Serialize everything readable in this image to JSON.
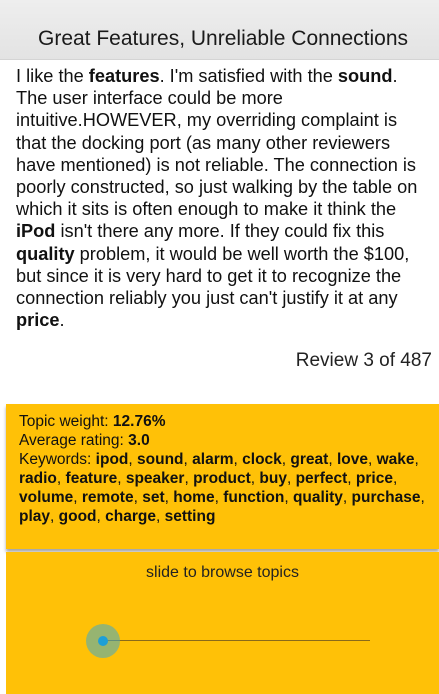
{
  "header": {
    "title": "Great Features, Unreliable Connections"
  },
  "review": {
    "segments": [
      {
        "text": "I like the ",
        "bold": false
      },
      {
        "text": "features",
        "bold": true
      },
      {
        "text": ". I'm satisfied with the ",
        "bold": false
      },
      {
        "text": "sound",
        "bold": true
      },
      {
        "text": ". The user interface could be more intuitive.HOWEVER, my overriding complaint is that the docking port (as many other reviewers have mentioned) is not reliable. The connection is poorly constructed, so just walking by the table on which it sits is often enough to make it think the ",
        "bold": false
      },
      {
        "text": "iPod",
        "bold": true
      },
      {
        "text": " isn't there any more. If they could fix this ",
        "bold": false
      },
      {
        "text": "quality",
        "bold": true
      },
      {
        "text": " problem, it would be well worth the $100, but since it is very hard to get it to recognize the connection reliably you just can't justify it at any ",
        "bold": false
      },
      {
        "text": "price",
        "bold": true
      },
      {
        "text": ".",
        "bold": false
      }
    ],
    "counter": "Review 3 of 487"
  },
  "topic": {
    "weight_label": "Topic weight: ",
    "weight_value": "12.76%",
    "rating_label": "Average rating: ",
    "rating_value": "3.0",
    "keywords_label": "Keywords: ",
    "keywords": [
      "ipod",
      "sound",
      "alarm",
      "clock",
      "great",
      "love",
      "wake",
      "radio",
      "feature",
      "speaker",
      "product",
      "buy",
      "perfect",
      "price",
      "volume",
      "remote",
      "set",
      "home",
      "function",
      "quality",
      "purchase",
      "play",
      "good",
      "charge",
      "setting"
    ]
  },
  "slider": {
    "caption": "slide to browse topics",
    "position": 0.0,
    "colors": {
      "panel": "#ffc107",
      "thumb": "#1e9fd6"
    }
  }
}
